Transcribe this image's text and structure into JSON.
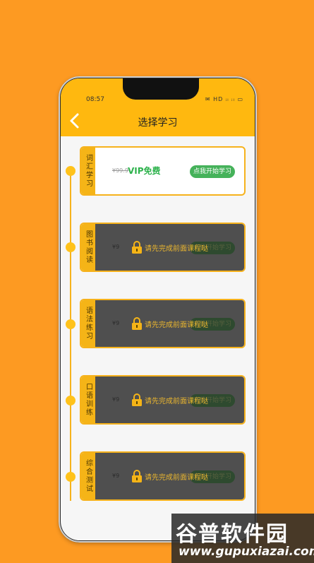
{
  "status": {
    "time": "08:57",
    "right": "✉ HD ᵢₗ ᵢₗ ▭"
  },
  "header": {
    "title": "选择学习"
  },
  "lock_message": "请先完成前面课程哒",
  "cards": [
    {
      "tab": "词汇学习",
      "price": "¥99.9",
      "vip": "VIP免费",
      "button": "点我开始学习",
      "locked": false
    },
    {
      "tab": "图书阅读",
      "price": "¥9",
      "button": "点我开始学习",
      "locked": true
    },
    {
      "tab": "语法练习",
      "price": "¥9",
      "button": "点我开始学习",
      "locked": true
    },
    {
      "tab": "口语训练",
      "price": "¥9",
      "button": "点我开始学习",
      "locked": true
    },
    {
      "tab": "综合测试",
      "price": "¥9",
      "button": "点我开始学习",
      "locked": true
    }
  ],
  "watermark": {
    "title": "谷普软件园",
    "url": "www.gupuxiazai.com"
  },
  "colors": {
    "background": "#FD9A22",
    "header": "#FFB80F",
    "accent": "#F6B21C",
    "vip_green": "#2DB24C"
  }
}
